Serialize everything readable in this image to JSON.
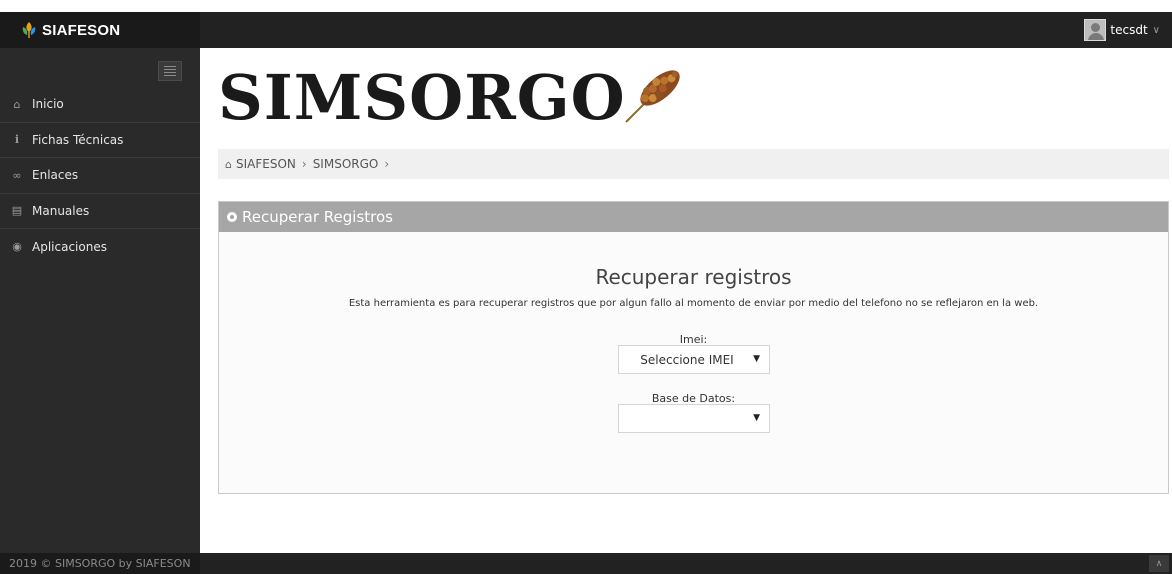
{
  "topbar": {
    "brand": "SIAFESON",
    "user_name": "tecsdt"
  },
  "sidebar": {
    "items": [
      {
        "label": "Inicio",
        "icon": "home-icon"
      },
      {
        "label": "Fichas Técnicas",
        "icon": "info-icon"
      },
      {
        "label": "Enlaces",
        "icon": "link-icon"
      },
      {
        "label": "Manuales",
        "icon": "book-icon"
      },
      {
        "label": "Aplicaciones",
        "icon": "android-icon"
      }
    ]
  },
  "main": {
    "logo_text": "SIMSORGO",
    "breadcrumb": [
      "SIAFESON",
      "SIMSORGO"
    ],
    "panel_title": "Recuperar Registros",
    "form_title": "Recuperar registros",
    "form_description": "Esta herramienta es para recuperar registros que por algun fallo al momento de enviar por medio del telefono no se reflejaron en la web.",
    "imei_label": "Imei:",
    "imei_value": "Seleccione IMEI",
    "db_label": "Base de Datos:",
    "db_value": ""
  },
  "footer": {
    "text": "2019 © SIMSORGO by SIAFESON"
  },
  "colors": {
    "topbar": "#222222",
    "sidebar": "#2a2a2a",
    "panel_header": "#a6a6a6",
    "breadcrumb_bg": "#f0f0f0"
  }
}
